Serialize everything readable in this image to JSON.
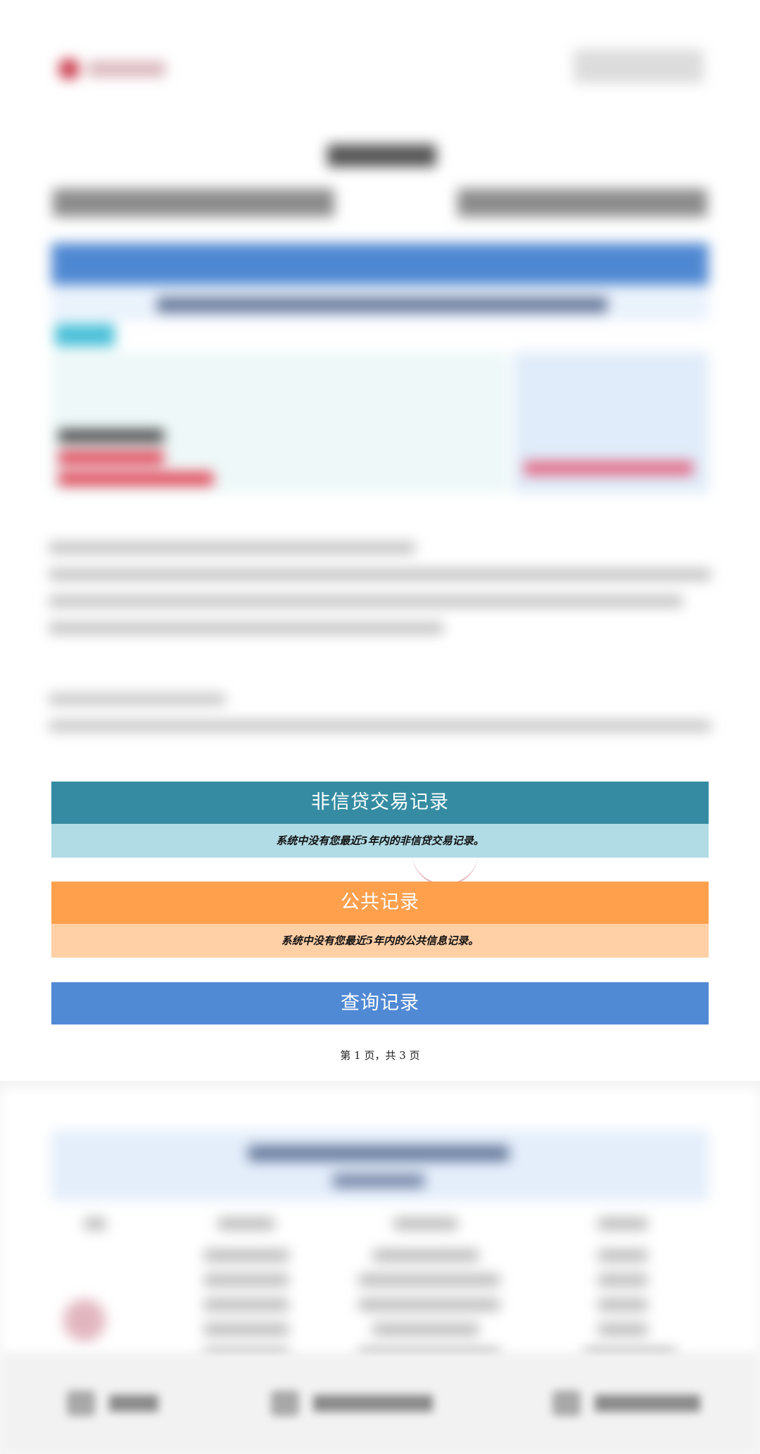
{
  "sections": {
    "non_credit": {
      "title": "非信贷交易记录",
      "message": "系统中没有您最近5年内的非信贷交易记录。"
    },
    "public_records": {
      "title": "公共记录",
      "message": "系统中没有您最近5年内的公共信息记录。"
    },
    "query_records": {
      "title": "查询记录"
    }
  },
  "footer": {
    "page_indicator": "第 1 页，共 3 页"
  },
  "colors": {
    "non_credit_header": "#358ca2",
    "non_credit_body": "#b1dbe5",
    "public_header": "#ffa04d",
    "public_body": "#ffcfa6",
    "query_header": "#5089d4"
  }
}
